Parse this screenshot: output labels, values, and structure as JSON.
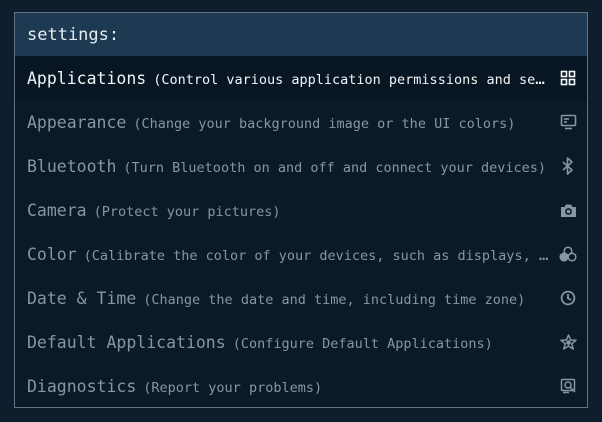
{
  "prompt": {
    "label": "settings:"
  },
  "items": [
    {
      "name": "Applications",
      "description": "(Control various application permissions and settings)",
      "icon": "applications-grid-icon"
    },
    {
      "name": "Appearance",
      "description": "(Change your background image or the UI colors)",
      "icon": "appearance-monitor-icon"
    },
    {
      "name": "Bluetooth",
      "description": "(Turn Bluetooth on and off and connect your devices)",
      "icon": "bluetooth-icon"
    },
    {
      "name": "Camera",
      "description": "(Protect your pictures)",
      "icon": "camera-icon"
    },
    {
      "name": "Color",
      "description": "(Calibrate the color of your devices, such as displays, cameras or printers)",
      "icon": "color-circles-icon"
    },
    {
      "name": "Date & Time",
      "description": "(Change the date and time, including time zone)",
      "icon": "clock-icon"
    },
    {
      "name": "Default Applications",
      "description": "(Configure Default Applications)",
      "icon": "star-icon"
    },
    {
      "name": "Diagnostics",
      "description": "(Report your problems)",
      "icon": "diagnostics-icon"
    }
  ],
  "colors": {
    "background": "#0f1e2c",
    "prompt_bar": "#1d3a52",
    "list_bg": "#0c1a27",
    "selected_bg": "#081523",
    "text_selected": "#f2f5f7",
    "text_normal": "#8796a3"
  }
}
